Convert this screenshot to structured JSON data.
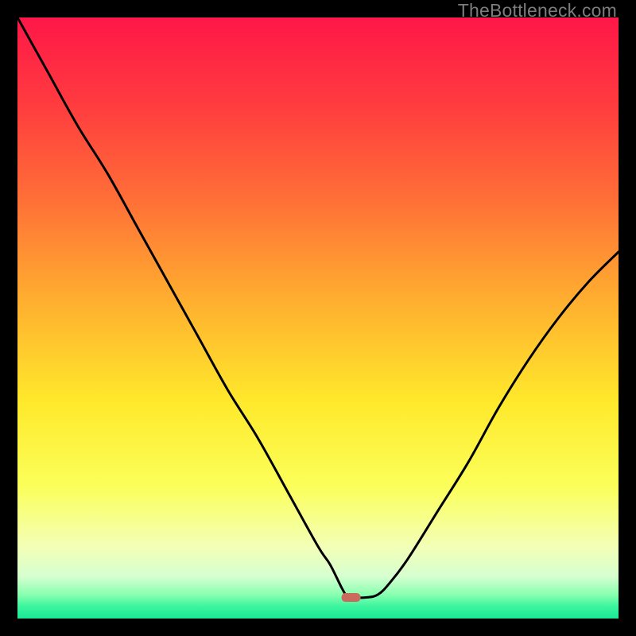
{
  "watermark": "TheBottleneck.com",
  "chart_data": {
    "type": "line",
    "title": "",
    "xlabel": "",
    "ylabel": "",
    "xlim": [
      0,
      100
    ],
    "ylim": [
      0,
      100
    ],
    "grid": false,
    "legend": false,
    "series": [
      {
        "name": "bottleneck-curve",
        "x": [
          0,
          5,
          10,
          15,
          20,
          25,
          30,
          35,
          40,
          45,
          50,
          52,
          54,
          55,
          56,
          58,
          60,
          62,
          65,
          70,
          75,
          80,
          85,
          90,
          95,
          100
        ],
        "values": [
          100,
          91,
          82,
          74,
          65,
          56,
          47,
          38,
          30,
          21,
          12,
          9,
          5,
          3.5,
          3.5,
          3.5,
          4,
          6,
          10,
          18,
          26,
          35,
          43,
          50,
          56,
          61
        ]
      }
    ],
    "marker": {
      "x": 55.5,
      "y": 3.5,
      "color": "#c96a5d"
    },
    "gradient_stops": [
      {
        "pct": 0,
        "color": "#ff1748"
      },
      {
        "pct": 14,
        "color": "#ff3a3f"
      },
      {
        "pct": 30,
        "color": "#ff6e37"
      },
      {
        "pct": 48,
        "color": "#ffb22f"
      },
      {
        "pct": 64,
        "color": "#ffe92b"
      },
      {
        "pct": 78,
        "color": "#fbff5a"
      },
      {
        "pct": 88,
        "color": "#f3ffb6"
      },
      {
        "pct": 93,
        "color": "#d6ffd0"
      },
      {
        "pct": 96,
        "color": "#8affb0"
      },
      {
        "pct": 98,
        "color": "#3bf59e"
      },
      {
        "pct": 100,
        "color": "#19e894"
      }
    ]
  }
}
